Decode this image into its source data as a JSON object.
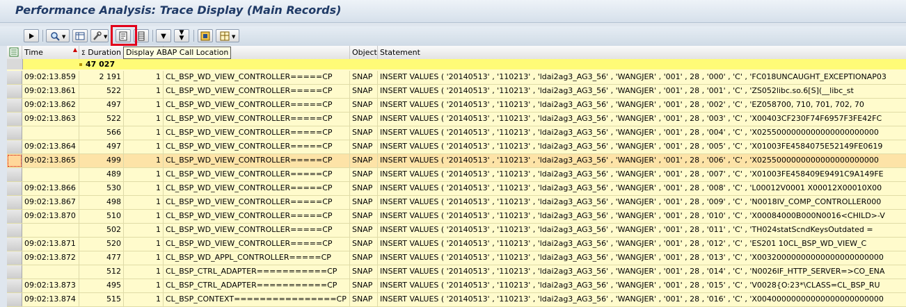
{
  "title": "Performance Analysis: Trace Display (Main Records)",
  "tooltip": "Display ABAP Call Location",
  "columns": {
    "time": "Time",
    "duration": "Duration",
    "records": "",
    "program": "",
    "object": "Object",
    "statement": "Statement"
  },
  "sum_glyph": "Σ",
  "total": "47 027",
  "rows": [
    {
      "time": "09:02:13.859",
      "duration": "2 191",
      "records": "1",
      "program": "CL_BSP_WD_VIEW_CONTROLLER=====CP",
      "object": "SNAP",
      "statement": "INSERT  VALUES ( '20140513' , '110213' , 'ldai2ag3_AG3_56' , 'WANGJER' , '001' , 28 , '000' , 'C' , 'FC018UNCAUGHT_EXCEPTIONAP03"
    },
    {
      "time": "09:02:13.861",
      "duration": "522",
      "records": "1",
      "program": "CL_BSP_WD_VIEW_CONTROLLER=====CP",
      "object": "SNAP",
      "statement": "INSERT  VALUES ( '20140513' , '110213' , 'ldai2ag3_AG3_56' , 'WANGJER' , '001' , 28 , '001' , 'C' , 'ZS052libc.so.6[S](__libc_st"
    },
    {
      "time": "09:02:13.862",
      "duration": "497",
      "records": "1",
      "program": "CL_BSP_WD_VIEW_CONTROLLER=====CP",
      "object": "SNAP",
      "statement": "INSERT  VALUES ( '20140513' , '110213' , 'ldai2ag3_AG3_56' , 'WANGJER' , '001' , 28 , '002' , 'C' , 'EZ058700, 710, 701, 702, 70"
    },
    {
      "time": "09:02:13.863",
      "duration": "522",
      "records": "1",
      "program": "CL_BSP_WD_VIEW_CONTROLLER=====CP",
      "object": "SNAP",
      "statement": "INSERT  VALUES ( '20140513' , '110213' , 'ldai2ag3_AG3_56' , 'WANGJER' , '001' , 28 , '003' , 'C' , 'X00403CF230F74F6957F3FE42FC"
    },
    {
      "time": "",
      "duration": "566",
      "records": "1",
      "program": "CL_BSP_WD_VIEW_CONTROLLER=====CP",
      "object": "SNAP",
      "statement": "INSERT  VALUES ( '20140513' , '110213' , 'ldai2ag3_AG3_56' , 'WANGJER' , '001' , 28 , '004' , 'C' , 'X0255000000000000000000000"
    },
    {
      "time": "09:02:13.864",
      "duration": "497",
      "records": "1",
      "program": "CL_BSP_WD_VIEW_CONTROLLER=====CP",
      "object": "SNAP",
      "statement": "INSERT  VALUES ( '20140513' , '110213' , 'ldai2ag3_AG3_56' , 'WANGJER' , '001' , 28 , '005' , 'C' , 'X01003FE4584075E52149FE0619"
    },
    {
      "time": "09:02:13.865",
      "duration": "499",
      "records": "1",
      "program": "CL_BSP_WD_VIEW_CONTROLLER=====CP",
      "object": "SNAP",
      "statement": "INSERT  VALUES ( '20140513' , '110213' , 'ldai2ag3_AG3_56' , 'WANGJER' , '001' , 28 , '006' , 'C' , 'X0255000000000000000000000",
      "selected": true
    },
    {
      "time": "",
      "duration": "489",
      "records": "1",
      "program": "CL_BSP_WD_VIEW_CONTROLLER=====CP",
      "object": "SNAP",
      "statement": "INSERT  VALUES ( '20140513' , '110213' , 'ldai2ag3_AG3_56' , 'WANGJER' , '001' , 28 , '007' , 'C' , 'X01003FE458409E9491C9A149FE"
    },
    {
      "time": "09:02:13.866",
      "duration": "530",
      "records": "1",
      "program": "CL_BSP_WD_VIEW_CONTROLLER=====CP",
      "object": "SNAP",
      "statement": "INSERT  VALUES ( '20140513' , '110213' , 'ldai2ag3_AG3_56' , 'WANGJER' , '001' , 28 , '008' , 'C' , 'L00012V0001 X00012X00010X00"
    },
    {
      "time": "09:02:13.867",
      "duration": "498",
      "records": "1",
      "program": "CL_BSP_WD_VIEW_CONTROLLER=====CP",
      "object": "SNAP",
      "statement": "INSERT  VALUES ( '20140513' , '110213' , 'ldai2ag3_AG3_56' , 'WANGJER' , '001' , 28 , '009' , 'C' , 'N0018IV_COMP_CONTROLLER000"
    },
    {
      "time": "09:02:13.870",
      "duration": "510",
      "records": "1",
      "program": "CL_BSP_WD_VIEW_CONTROLLER=====CP",
      "object": "SNAP",
      "statement": "INSERT  VALUES ( '20140513' , '110213' , 'ldai2ag3_AG3_56' , 'WANGJER' , '001' , 28 , '010' , 'C' , 'X00084000B000N0016<CHILD>-V"
    },
    {
      "time": "",
      "duration": "502",
      "records": "1",
      "program": "CL_BSP_WD_VIEW_CONTROLLER=====CP",
      "object": "SNAP",
      "statement": "INSERT  VALUES ( '20140513' , '110213' , 'ldai2ag3_AG3_56' , 'WANGJER' , '001' , 28 , '011' , 'C' , 'TH024statScndKeysOutdated ="
    },
    {
      "time": "09:02:13.871",
      "duration": "520",
      "records": "1",
      "program": "CL_BSP_WD_VIEW_CONTROLLER=====CP",
      "object": "SNAP",
      "statement": "INSERT  VALUES ( '20140513' , '110213' , 'ldai2ag3_AG3_56' , 'WANGJER' , '001' , 28 , '012' , 'C' , 'ES201    10CL_BSP_WD_VIEW_C"
    },
    {
      "time": "09:02:13.872",
      "duration": "477",
      "records": "1",
      "program": "CL_BSP_WD_APPL_CONTROLLER=====CP",
      "object": "SNAP",
      "statement": "INSERT  VALUES ( '20140513' , '110213' , 'ldai2ag3_AG3_56' , 'WANGJER' , '001' , 28 , '013' , 'C' , 'X00320000000000000000000000"
    },
    {
      "time": "",
      "duration": "512",
      "records": "1",
      "program": "CL_BSP_CTRL_ADAPTER===========CP",
      "object": "SNAP",
      "statement": "INSERT  VALUES ( '20140513' , '110213' , 'ldai2ag3_AG3_56' , 'WANGJER' , '001' , 28 , '014' , 'C' , 'N0026IF_HTTP_SERVER=>CO_ENA"
    },
    {
      "time": "09:02:13.873",
      "duration": "495",
      "records": "1",
      "program": "CL_BSP_CTRL_ADAPTER===========CP",
      "object": "SNAP",
      "statement": "INSERT  VALUES ( '20140513' , '110213' , 'ldai2ag3_AG3_56' , 'WANGJER' , '001' , 28 , '015' , 'C' , 'V0028{O:23*\\CLASS=CL_BSP_RU"
    },
    {
      "time": "09:02:13.874",
      "duration": "515",
      "records": "1",
      "program": "CL_BSP_CONTEXT================CP",
      "object": "SNAP",
      "statement": "INSERT  VALUES ( '20140513' , '110213' , 'ldai2ag3_AG3_56' , 'WANGJER' , '001' , 28 , '016' , 'C' , 'X00400000000000000000000000"
    }
  ],
  "colors": {
    "row_bg": "#fffbcc",
    "selected_row": "#fde3a7",
    "sum_row": "#fffb77",
    "highlight_box": "#e2001a"
  }
}
